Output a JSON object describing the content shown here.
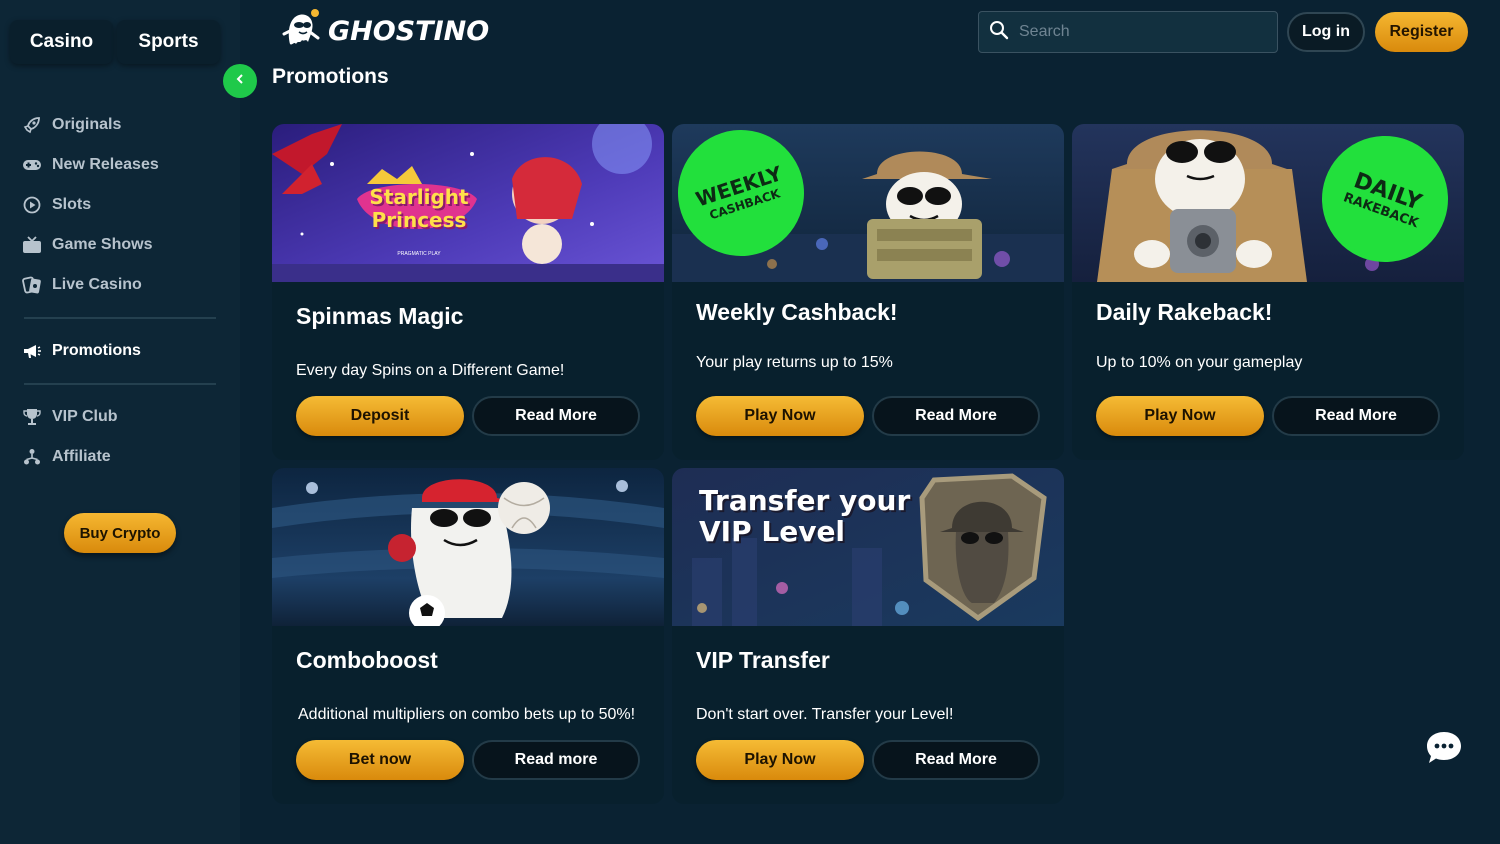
{
  "header": {
    "brand": "GHOSTINO",
    "search_placeholder": "Search",
    "login_label": "Log in",
    "register_label": "Register"
  },
  "sidebar": {
    "tabs": [
      "Casino",
      "Sports"
    ],
    "items": [
      {
        "label": "Originals",
        "icon": "rocket-icon"
      },
      {
        "label": "New Releases",
        "icon": "gamepad-icon"
      },
      {
        "label": "Slots",
        "icon": "slots-icon"
      },
      {
        "label": "Game Shows",
        "icon": "tv-icon"
      },
      {
        "label": "Live Casino",
        "icon": "cards-icon"
      }
    ],
    "promotions": {
      "label": "Promotions",
      "icon": "megaphone-icon"
    },
    "bottom_items": [
      {
        "label": "VIP Club",
        "icon": "trophy-icon"
      },
      {
        "label": "Affiliate",
        "icon": "network-icon"
      }
    ],
    "buy_crypto_label": "Buy Crypto"
  },
  "page": {
    "title": "Promotions"
  },
  "promotions": [
    {
      "title": "Spinmas Magic",
      "description": "Every day Spins on a Different Game!",
      "primary": "Deposit",
      "secondary": "Read More",
      "banner_text": "Starlight Princess",
      "banner_sub": "PRAGMATIC PLAY"
    },
    {
      "title": "Weekly Cashback!",
      "description": "Your play returns up to 15%",
      "primary": "Play Now",
      "secondary": "Read More",
      "badge_line1": "WEEKLY",
      "badge_line2": "CASHBACK"
    },
    {
      "title": "Daily Rakeback!",
      "description": "Up to 10% on your gameplay",
      "primary": "Play Now",
      "secondary": "Read More",
      "badge_line1": "DAILY",
      "badge_line2": "RAKEBACK"
    },
    {
      "title": "Comboboost",
      "description": "Additional multipliers on combo bets up to 50%!",
      "primary": "Bet now",
      "secondary": "Read more"
    },
    {
      "title": "VIP Transfer",
      "description": "Don't start over. Transfer your Level!",
      "primary": "Play Now",
      "secondary": "Read More",
      "banner_line1": "Transfer your",
      "banner_line2": "VIP Level"
    }
  ],
  "colors": {
    "accent_gold": "#f5b731",
    "back_green": "#1fc94a",
    "badge_green": "#22e03c"
  }
}
